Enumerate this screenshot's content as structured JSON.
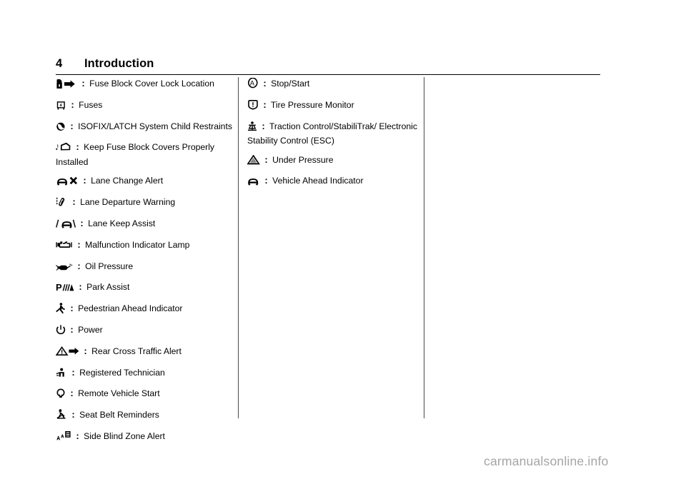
{
  "page": {
    "number": "4",
    "title": "Introduction"
  },
  "columns": [
    {
      "id": "left",
      "entries": [
        {
          "icon": "fuse-block-cover-lock-icon",
          "separator": ":",
          "label": "Fuse Block Cover Lock Location"
        },
        {
          "icon": "fuses-icon",
          "separator": ":",
          "label": "Fuses"
        },
        {
          "icon": "isofix-latch-child-restraint-icon",
          "separator": ":",
          "label": "ISOFIX/LATCH System Child Restraints"
        },
        {
          "icon": "keep-fuse-block-covers-installed-icon",
          "separator": ":",
          "label": "Keep Fuse Block Covers Properly Installed"
        },
        {
          "icon": "lane-change-alert-icon",
          "separator": ":",
          "label": "Lane Change Alert"
        },
        {
          "icon": "lane-departure-warning-icon",
          "separator": ":",
          "label": "Lane Departure Warning"
        },
        {
          "icon": "lane-keep-assist-icon",
          "separator": ":",
          "label": "Lane Keep Assist"
        },
        {
          "icon": "malfunction-indicator-lamp-icon",
          "separator": ":",
          "label": "Malfunction Indicator Lamp"
        },
        {
          "icon": "oil-pressure-icon",
          "separator": ":",
          "label": "Oil Pressure"
        },
        {
          "icon": "park-assist-icon",
          "separator": ":",
          "label": "Park Assist"
        },
        {
          "icon": "pedestrian-ahead-indicator-icon",
          "separator": ":",
          "label": "Pedestrian Ahead Indicator"
        },
        {
          "icon": "power-icon",
          "separator": ":",
          "label": "Power"
        },
        {
          "icon": "rear-cross-traffic-alert-icon",
          "separator": ":",
          "label": "Rear Cross Traffic Alert"
        },
        {
          "icon": "registered-technician-icon",
          "separator": ":",
          "label": "Registered Technician"
        },
        {
          "icon": "remote-vehicle-start-icon",
          "separator": ":",
          "label": "Remote Vehicle Start"
        },
        {
          "icon": "seat-belt-reminders-icon",
          "separator": ":",
          "label": "Seat Belt Reminders"
        },
        {
          "icon": "side-blind-zone-alert-icon",
          "separator": ":",
          "label": "Side Blind Zone Alert"
        }
      ]
    },
    {
      "id": "right",
      "entries": [
        {
          "icon": "stop-start-icon",
          "separator": ":",
          "label": "Stop/Start"
        },
        {
          "icon": "tire-pressure-monitor-icon",
          "separator": ":",
          "label": "Tire Pressure Monitor"
        },
        {
          "icon": "traction-control-icon",
          "separator": ":",
          "label": "Traction Control/StabiliTrak/ Electronic Stability Control (ESC)"
        },
        {
          "icon": "under-pressure-icon",
          "separator": ":",
          "label": "Under Pressure"
        },
        {
          "icon": "vehicle-ahead-indicator-icon",
          "separator": ":",
          "label": "Vehicle Ahead Indicator"
        }
      ]
    }
  ],
  "watermark": {
    "text": "carmanualsonline.info",
    "color": "#a5a5a5"
  }
}
